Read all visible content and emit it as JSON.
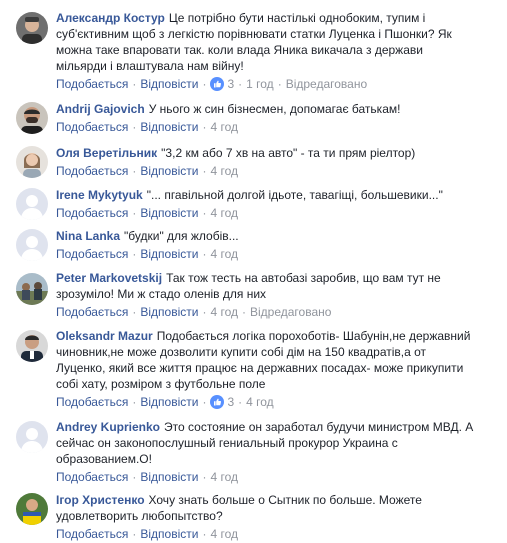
{
  "action_labels": {
    "like": "Подобається",
    "reply": "Відповісти",
    "edited": "Відредаговано"
  },
  "comments": [
    {
      "author": "Александр Костур",
      "text": "Це потрібно бути настількі однобоким, тупим і суб'єктивним щоб з легкістю порівнювати статки Луценка і Пшонки? Як можна таке впаровати так. коли влада Яника викачала з держави мільярди і влаштувала нам війну!",
      "reactions": "3",
      "time": "1 год",
      "edited": "Відредаговано"
    },
    {
      "author": "Andrij Gajovich",
      "text": "У нього ж син бізнесмен, допомагає батькам!",
      "time": "4 год"
    },
    {
      "author": "Оля Веретільник",
      "text": "\"3,2 км або 7 хв на авто\" - та ти прям ріелтор)",
      "time": "4 год"
    },
    {
      "author": "Irene Mykytyuk",
      "text": "\"... пгавільной долгой ідьоте, тавагіщі, большевики...\"",
      "time": "4 год"
    },
    {
      "author": "Nina Lanka",
      "text": "\"будки\" для жлобів...",
      "time": "4 год"
    },
    {
      "author": "Peter Markovetskij",
      "text": "Так тож тесть на автобазі заробив, що вам тут не зрозуміло! Ми ж стадо оленів для них",
      "time": "4 год",
      "edited": "Відредаговано"
    },
    {
      "author": "Oleksandr Mazur",
      "text": "Подобається логіка порохоботів- Шабунін,не державний чиновник,не може дозволити купити собі дім на 150 квадратів,а от Луценко, який все життя працює на державних посадах- може прикупити собі хату, розміром з футбольне поле",
      "reactions": "3",
      "time": "4 год"
    },
    {
      "author": "Andrey Kuprienko",
      "text": "Это состояние он заработал будучи министром МВД. А сейчас он законопослушный гениальный прокурор Украина с образованием.О!",
      "time": "4 год"
    },
    {
      "author": "Ігор Христенко",
      "text": "Хочу знать больше о Сытник по больше. Можете удовлетворить любопытство?",
      "time": "4 год"
    }
  ]
}
